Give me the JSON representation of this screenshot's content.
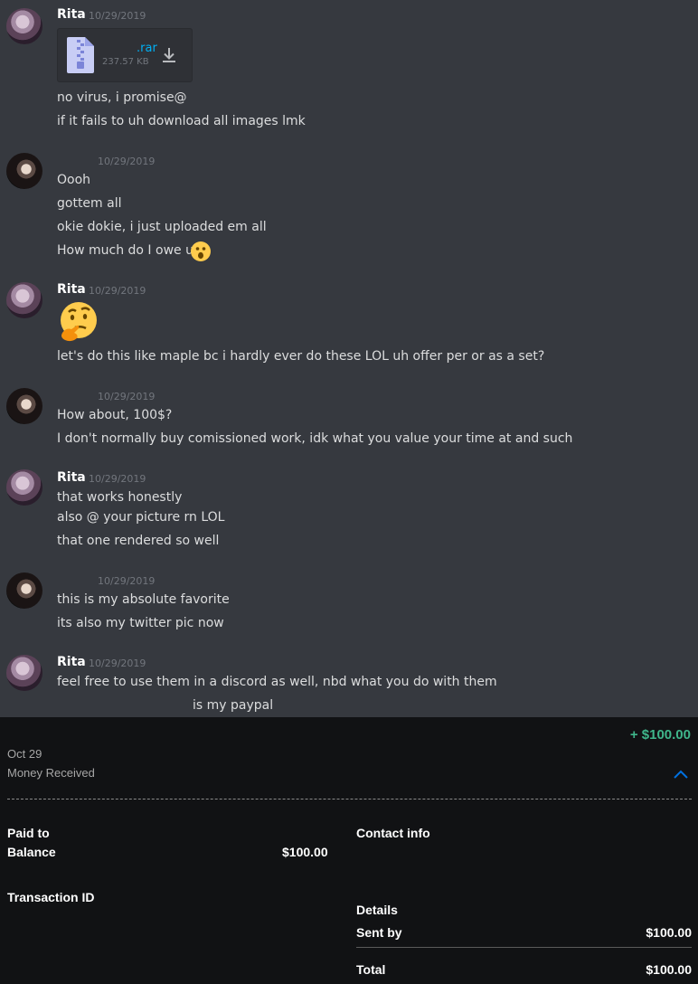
{
  "chat": {
    "groups": [
      {
        "user": "Rita",
        "timestamp": "10/29/2019",
        "attachment": {
          "name": ".rar",
          "size": "237.57 KB"
        },
        "messages": [
          "no virus, i promise@",
          "if it fails to uh download all images lmk"
        ]
      },
      {
        "user": "",
        "timestamp": "10/29/2019",
        "messages": [
          "Oooh",
          "gottem all",
          "okie dokie, i just uploaded em all",
          "How much do I owe u"
        ]
      },
      {
        "user": "Rita",
        "timestamp": "10/29/2019",
        "messages": [
          "let's do this like maple bc i hardly ever do these LOL uh offer per or as a set?"
        ]
      },
      {
        "user": "",
        "timestamp": "10/29/2019",
        "messages": [
          "How about, 100$?",
          "I don't normally buy comissioned work, idk what you value your time at and such"
        ]
      },
      {
        "user": "Rita",
        "timestamp": "10/29/2019",
        "messages": [
          "that works honestly",
          "also @ your picture rn LOL",
          "that one rendered so well"
        ]
      },
      {
        "user": "",
        "timestamp": "10/29/2019",
        "messages": [
          "this is my absolute favorite",
          "its also my twitter pic now"
        ]
      },
      {
        "user": "Rita",
        "timestamp": "10/29/2019",
        "messages": [
          "feel free to use them in a discord as well, nbd what you do with them",
          "is my paypal"
        ]
      }
    ],
    "emojis": {
      "astonished": "astonished-emoji",
      "thinking": "thinking-emoji"
    }
  },
  "paypal": {
    "amount": "+ $100.00",
    "date": "Oct 29",
    "status": "Money Received",
    "paid_to_label": "Paid to",
    "balance_label": "Balance",
    "balance_value": "$100.00",
    "contact_label": "Contact info",
    "transaction_label": "Transaction ID",
    "details_label": "Details",
    "sent_by_label": "Sent by",
    "sent_by_value": "$100.00",
    "total_label": "Total",
    "total_value": "$100.00",
    "colors": {
      "amount": "#3fb68b",
      "chevron": "#0070e0"
    }
  }
}
